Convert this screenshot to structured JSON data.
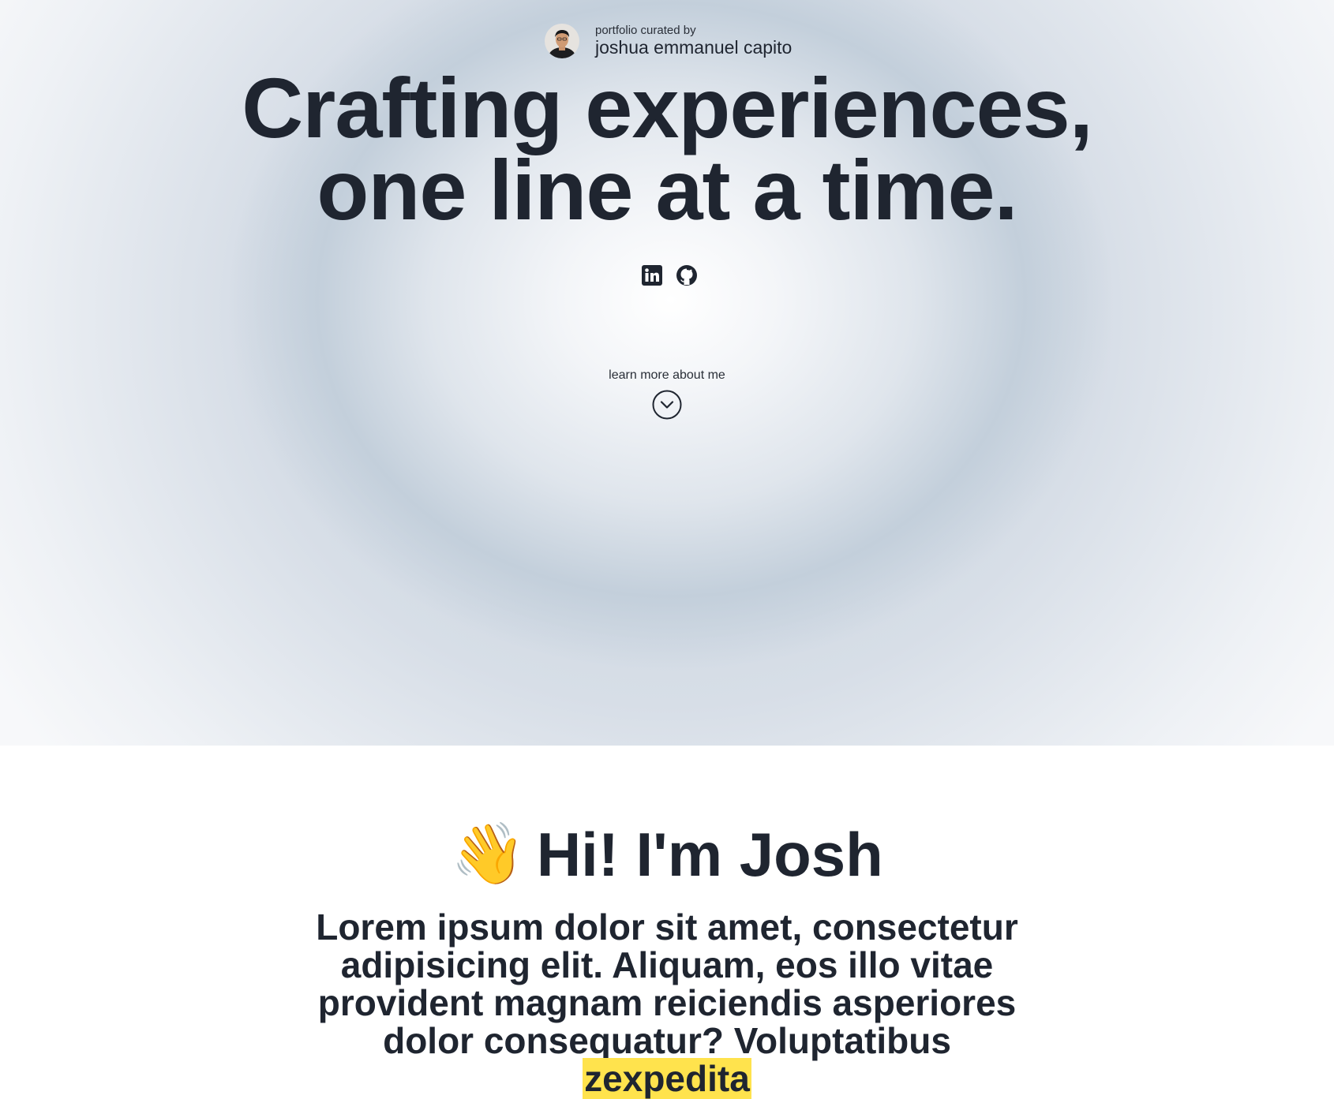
{
  "curator": {
    "pre_label": "portfolio curated by",
    "name": "joshua emmanuel capito"
  },
  "hero": {
    "headline_line1": "Crafting experiences,",
    "headline_line2": "one line at a time.",
    "socials": [
      {
        "name": "linkedin",
        "icon": "linkedin-icon"
      },
      {
        "name": "github",
        "icon": "github-icon"
      }
    ],
    "learn_more_label": "learn more about me",
    "learn_more_icon": "chevron-down-circle-icon"
  },
  "about": {
    "wave_emoji": "👋",
    "title": "Hi! I'm Josh",
    "text_main": "Lorem ipsum dolor sit amet, consectetur adipisicing elit. Aliquam, eos illo vitae provident magnam reiciendis asperiores dolor consequatur? Voluptatibus ",
    "text_highlight": "zexpedita"
  },
  "colors": {
    "text": "#1f2530",
    "highlight": "#ffe34d",
    "hero_tint": "#c3cfdb"
  }
}
